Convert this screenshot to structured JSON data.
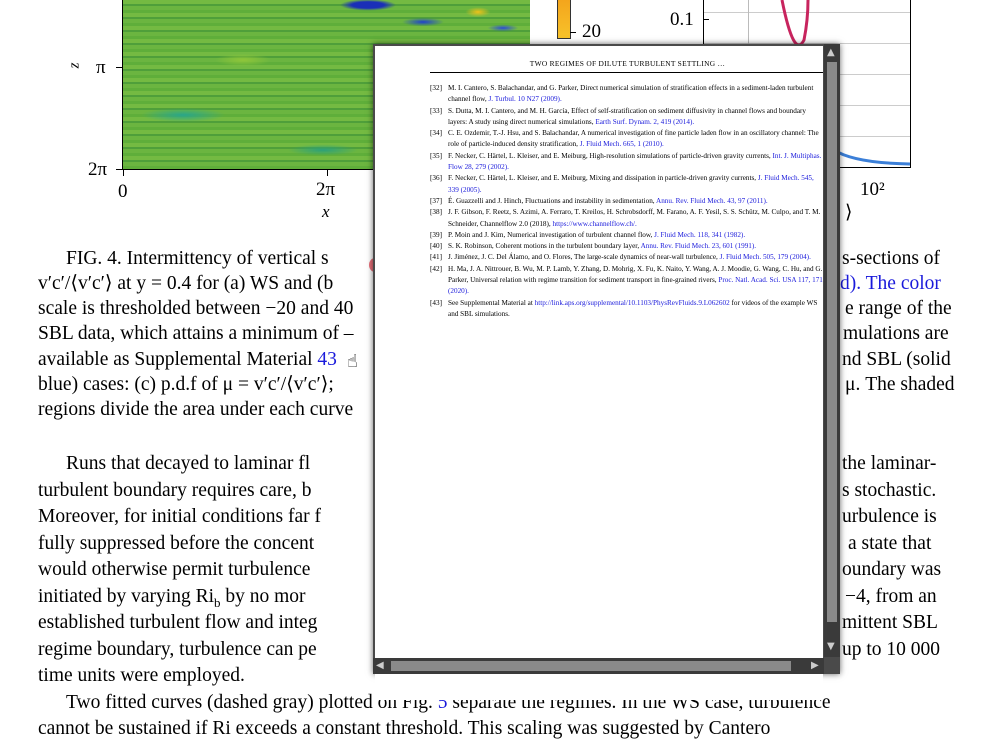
{
  "figure": {
    "y_axis_label": "z",
    "y_ticks": [
      "π",
      "2π"
    ],
    "x_ticks": [
      "0",
      "2π"
    ],
    "x_axis_label": "x",
    "colorbar_tick": "20",
    "logplot_y_tick": "0.1",
    "logplot_x_tick": "10²",
    "logplot_x_label_frag": "⟩"
  },
  "body_text": {
    "caption_lines": [
      "FIG. 4. Intermittency of vertical s",
      "s-sections of",
      "v′c′/⟨v′c′⟩ at y = 0.4 for (a) WS and (b",
      "d). The color",
      "scale is thresholded between −20 and 40",
      "e range of the",
      "SBL data, which attains a minimum of –",
      "mulations are",
      "available as Supplemental Material ",
      "43",
      "nd SBL (solid",
      "blue) cases: (c) p.d.f of μ = v′c′/⟨v′c′⟩;",
      "μ. The shaded",
      "regions divide the area under each curve"
    ],
    "para1_lines": [
      "Runs that decayed to laminar fl",
      "the laminar-",
      "turbulent boundary requires care, b",
      "s stochastic.",
      "Moreover, for initial conditions far f",
      "urbulence is",
      "fully suppressed before the concent",
      "a state that",
      "would otherwise permit turbulence",
      "oundary was",
      "initiated by varying Ri",
      "b",
      " by no mor",
      "−4, from an",
      "established turbulent flow and integ",
      "mittent SBL",
      "regime boundary, turbulence can pe",
      "up to 10 000",
      "time units were employed."
    ],
    "para2_line1a": "Two fitted curves (dashed gray) plotted on Fig. ",
    "para2_link": "5",
    "para2_line1b": " separate the regimes. In the WS case, turbulence",
    "para2_line2": "cannot be sustained if Ri",
    "para2_line2b": " exceeds a constant threshold. This scaling was suggested by Cantero"
  },
  "popup": {
    "header": "TWO REGIMES OF DILUTE TURBULENT SETTLING …",
    "references": [
      {
        "num": "[32]",
        "text": "M. I. Cantero, S. Balachandar, and G. Parker, Direct numerical simulation of stratification effects in a sediment-laden turbulent channel flow, ",
        "link": "J. Turbul. 10 N27 (2009)."
      },
      {
        "num": "[33]",
        "text": "S. Dutta, M. I. Cantero, and M. H. García, Effect of self-stratification on sediment diffusivity in channel flows and boundary layers: A study using direct numerical simulations, ",
        "link": "Earth Surf. Dynam. 2, 419 (2014)."
      },
      {
        "num": "[34]",
        "text": "C. E. Ozdemir, T.-J. Hsu, and S. Balachandar, A numerical investigation of fine particle laden flow in an oscillatory channel: The role of particle-induced density stratification, ",
        "link": "J. Fluid Mech. 665, 1 (2010)."
      },
      {
        "num": "[35]",
        "text": "F. Necker, C. Härtel, L. Kleiser, and E. Meiburg, High-resolution simulations of particle-driven gravity currents, ",
        "link": "Int. J. Multiphas. Flow 28, 279 (2002)."
      },
      {
        "num": "[36]",
        "text": "F. Necker, C. Härtel, L. Kleiser, and E. Meiburg, Mixing and dissipation in particle-driven gravity currents, ",
        "link": "J. Fluid Mech. 545, 339 (2005)."
      },
      {
        "num": "[37]",
        "text": "É. Guazzelli and J. Hinch, Fluctuations and instability in sedimentation, ",
        "link": "Annu. Rev. Fluid Mech. 43, 97 (2011)."
      },
      {
        "num": "[38]",
        "text": "J. F. Gibson, F. Reetz, S. Azimi, A. Ferraro, T. Kreilos, H. Schrobsdorff, M. Farano, A. F. Yesil, S. S. Schütz, M. Culpo, and T. M. Schneider, Channelflow 2.0 (2018), ",
        "link": "https://www.channelflow.ch/."
      },
      {
        "num": "[39]",
        "text": "P. Moin and J. Kim, Numerical investigation of turbulent channel flow, ",
        "link": "J. Fluid Mech. 118, 341 (1982)."
      },
      {
        "num": "[40]",
        "text": "S. K. Robinson, Coherent motions in the turbulent boundary layer, ",
        "link": "Annu. Rev. Fluid Mech. 23, 601 (1991)."
      },
      {
        "num": "[41]",
        "text": "J. Jiménez, J. C. Del Álamo, and O. Flores, The large-scale dynamics of near-wall turbulence, ",
        "link": "J. Fluid Mech. 505, 179 (2004)."
      },
      {
        "num": "[42]",
        "text": "H. Ma, J. A. Nittrouer, B. Wu, M. P. Lamb, Y. Zhang, D. Mohrig, X. Fu, K. Naito, Y. Wang, A. J. Moodie, G. Wang, C. Hu, and G. Parker, Universal relation with regime transition for sediment transport in fine-grained rivers, ",
        "link": "Proc. Natl. Acad. Sci. USA 117, 171 (2020)."
      },
      {
        "num": "[43]",
        "text": "See Supplemental Material at ",
        "link": "http://link.aps.org/supplemental/10.1103/PhysRevFluids.9.L062602",
        "text2": " for videos of the example WS and SBL simulations."
      }
    ],
    "scroll_left": "◀",
    "scroll_right": "▶",
    "scroll_up": "▲",
    "scroll_down": "▼"
  },
  "cursor": "☝"
}
